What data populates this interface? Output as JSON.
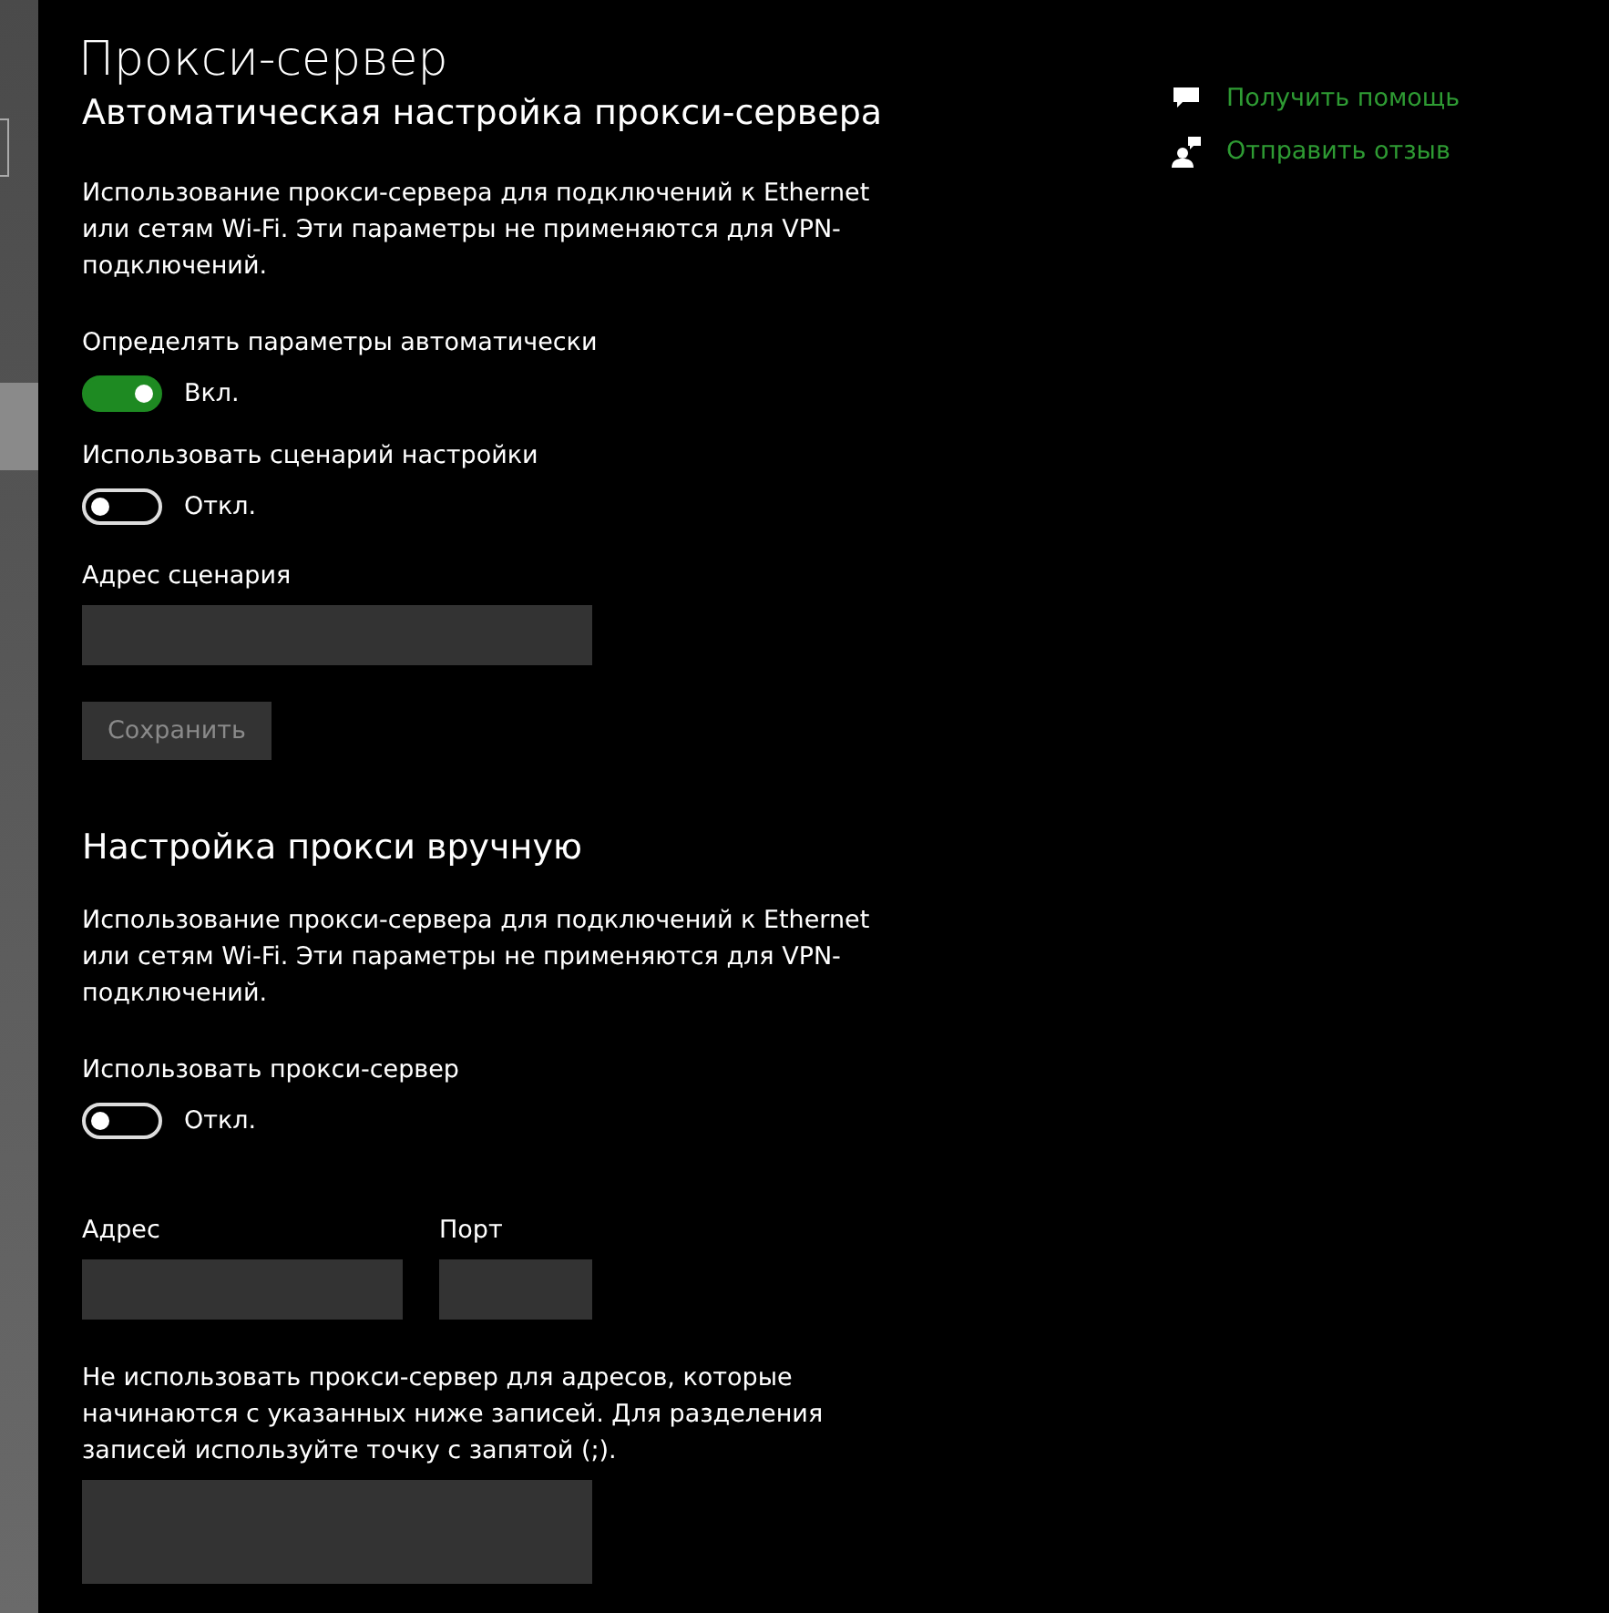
{
  "page_title": "Прокси-сервер",
  "related_links": [
    {
      "kind": "help",
      "label": "Получить помощь"
    },
    {
      "kind": "feedback",
      "label": "Отправить отзыв"
    }
  ],
  "auto_section": {
    "heading": "Автоматическая настройка прокси-сервера",
    "description": "Использование прокси-сервера для подключений к Ethernet или сетям Wi-Fi. Эти параметры не применяются для VPN-подключений.",
    "toggles": [
      {
        "label": "Определять параметры автоматически",
        "on": true,
        "state_text": "Вкл."
      },
      {
        "label": "Использовать сценарий настройки",
        "on": false,
        "state_text": "Откл."
      }
    ],
    "script_address": {
      "label": "Адрес сценария"
    },
    "save_button": {
      "label": "Сохранить",
      "disabled": true
    }
  },
  "manual_section": {
    "heading": "Настройка прокси вручную",
    "description": "Использование прокси-сервера для подключений к Ethernet или сетям Wi-Fi. Эти параметры не применяются для VPN-подключений.",
    "toggle": {
      "label": "Использовать прокси-сервер",
      "on": false,
      "state_text": "Откл."
    },
    "address": {
      "label": "Адрес"
    },
    "port": {
      "label": "Порт"
    },
    "exceptions": {
      "label": "Не использовать прокси-сервер для адресов, которые начинаются с указанных ниже записей. Для разделения записей используйте точку с запятой (;)."
    }
  }
}
